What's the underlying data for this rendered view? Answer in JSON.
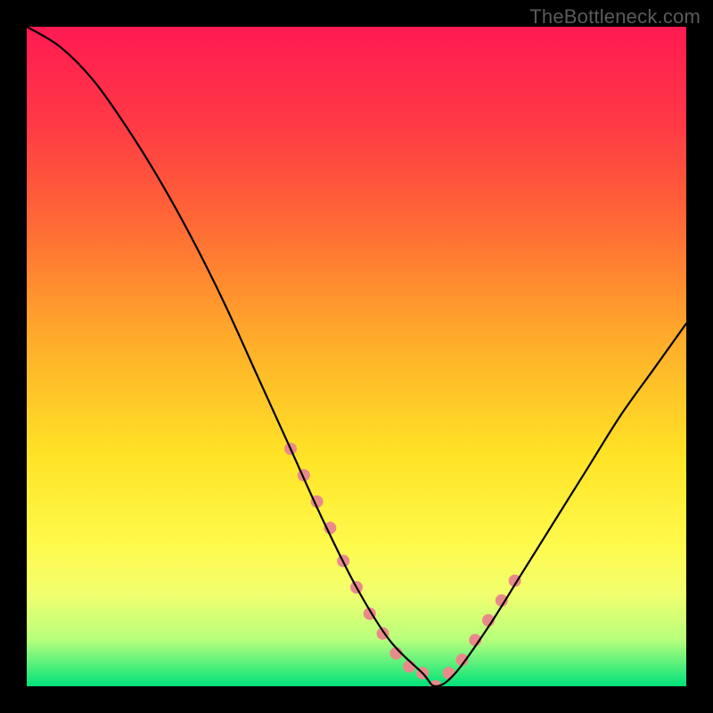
{
  "watermark": "TheBottleneck.com",
  "chart_data": {
    "type": "line",
    "title": "",
    "xlabel": "",
    "ylabel": "",
    "xlim": [
      0,
      100
    ],
    "ylim": [
      0,
      100
    ],
    "grid": false,
    "legend": false,
    "background_gradient": {
      "direction": "vertical",
      "stops": [
        {
          "pos": 0,
          "color": "#ff1a52"
        },
        {
          "pos": 50,
          "color": "#ffae2a"
        },
        {
          "pos": 80,
          "color": "#fff94a"
        },
        {
          "pos": 100,
          "color": "#00e27a"
        }
      ]
    },
    "series": [
      {
        "name": "bottleneck-curve",
        "color": "#000000",
        "x": [
          0,
          5,
          10,
          15,
          20,
          25,
          30,
          35,
          40,
          45,
          50,
          55,
          60,
          62,
          65,
          70,
          75,
          80,
          85,
          90,
          95,
          100
        ],
        "values": [
          100,
          97,
          92,
          85,
          77,
          68,
          58,
          47,
          36,
          25,
          15,
          7,
          2,
          0,
          2,
          9,
          17,
          25,
          33,
          41,
          48,
          55
        ]
      }
    ],
    "highlight_points": {
      "color": "#e98a8a",
      "radius": 7,
      "x": [
        40,
        42,
        44,
        46,
        48,
        50,
        52,
        54,
        56,
        58,
        60,
        62,
        64,
        66,
        68,
        70,
        72,
        74
      ],
      "values": [
        36,
        32,
        28,
        24,
        19,
        15,
        11,
        8,
        5,
        3,
        2,
        0,
        2,
        4,
        7,
        10,
        13,
        16
      ]
    }
  }
}
